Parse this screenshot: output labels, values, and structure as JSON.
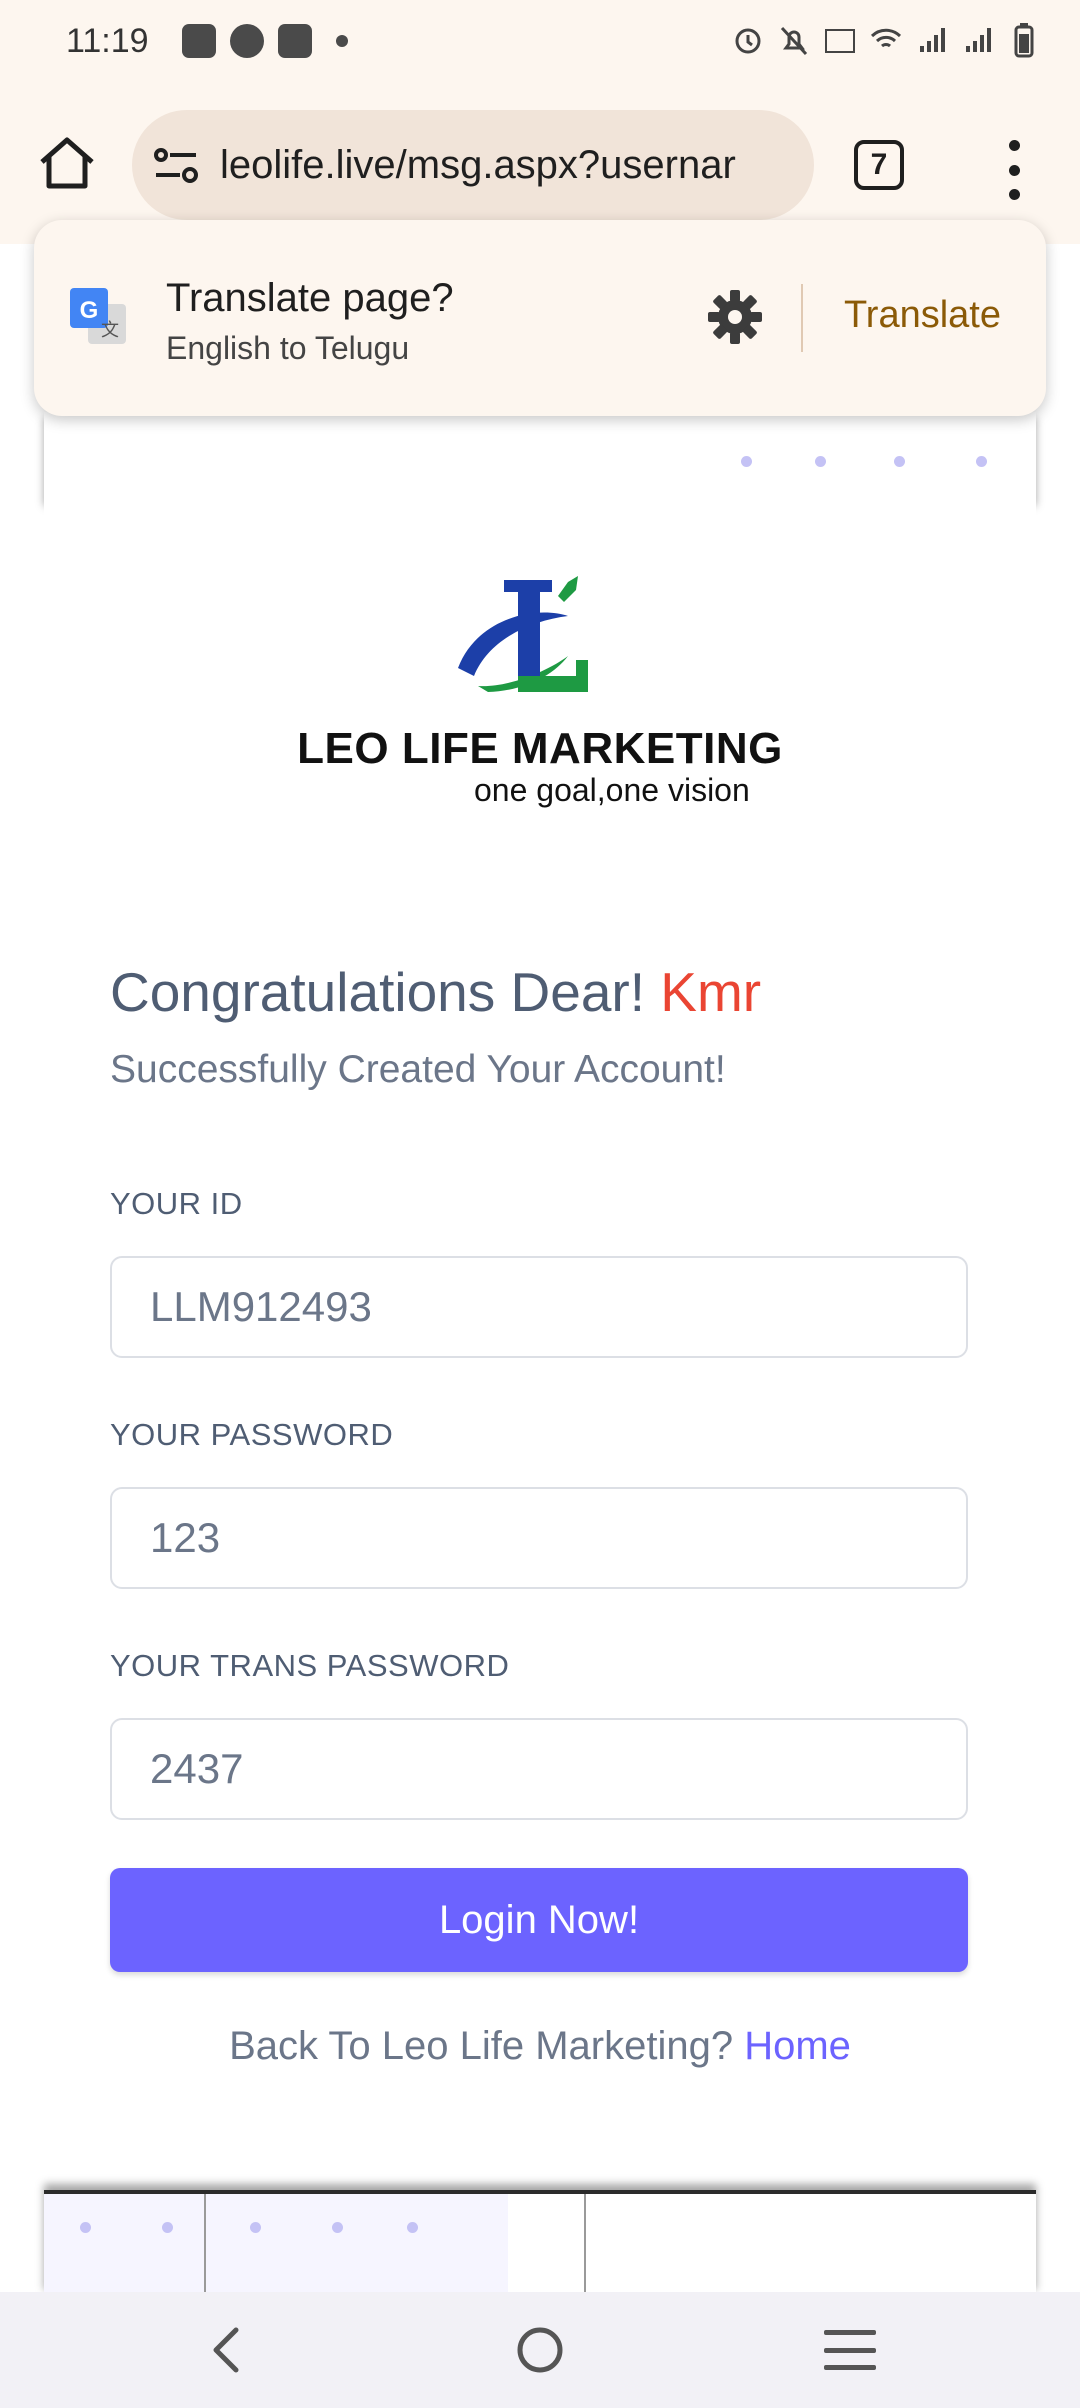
{
  "status_bar": {
    "time": "11:19",
    "left_icons": [
      "gmail-icon",
      "spotify-icon",
      "youtube-icon",
      "dot-icon"
    ],
    "right_icons": [
      "alarm-icon",
      "mute-icon",
      "volte-icon",
      "wifi-icon",
      "signal-icon",
      "signal-icon",
      "battery-icon"
    ]
  },
  "browser": {
    "url": "leolife.live/msg.aspx?usernar",
    "tab_count": "7"
  },
  "translate_popup": {
    "title": "Translate page?",
    "subtitle": "English to Telugu",
    "action": "Translate"
  },
  "logo": {
    "name": "LEO LIFE MARKETING",
    "tagline": "one goal,one vision",
    "colors": {
      "blue": "#1c3fa8",
      "green": "#1e9a43"
    }
  },
  "page": {
    "congrats_prefix": "Congratulations Dear!",
    "user_name": "Kmr",
    "success_text": "Successfully Created Your Account!",
    "fields": [
      {
        "label": "YOUR ID",
        "value": "LLM912493"
      },
      {
        "label": "YOUR PASSWORD",
        "value": "123"
      },
      {
        "label": "YOUR TRANS PASSWORD",
        "value": "2437"
      }
    ],
    "login_button": "Login Now!",
    "back_text": "Back To Leo Life Marketing?",
    "home_link": "Home"
  },
  "colors": {
    "accent": "#6c63ff",
    "name_highlight": "#ea4533",
    "heading": "#4f5d73",
    "translate_link": "#8b5a07"
  }
}
